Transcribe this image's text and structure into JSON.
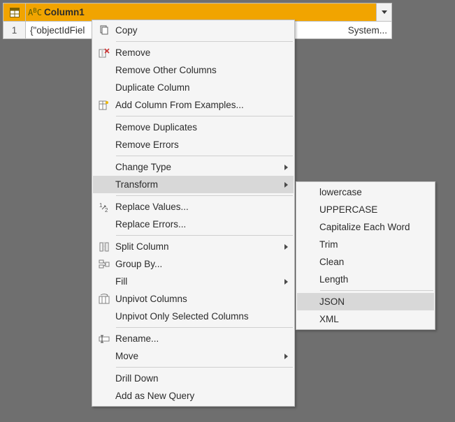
{
  "grid": {
    "column_type_prefix": "A",
    "column_type_suffix_sub": "B",
    "column_type_suffix": "C",
    "column_name": "Column1",
    "row_number": "1",
    "cell_value_left": "{\"objectIdFiel",
    "cell_value_right": "System..."
  },
  "menu1": {
    "copy": "Copy",
    "remove": "Remove",
    "remove_other": "Remove Other Columns",
    "duplicate": "Duplicate Column",
    "add_from_examples": "Add Column From Examples...",
    "remove_dups": "Remove Duplicates",
    "remove_errors": "Remove Errors",
    "change_type": "Change Type",
    "transform": "Transform",
    "replace_values": "Replace Values...",
    "replace_errors": "Replace Errors...",
    "split_column": "Split Column",
    "group_by": "Group By...",
    "fill": "Fill",
    "unpivot": "Unpivot Columns",
    "unpivot_sel": "Unpivot Only Selected Columns",
    "rename": "Rename...",
    "move": "Move",
    "drill_down": "Drill Down",
    "add_as_query": "Add as New Query"
  },
  "menu2": {
    "lowercase": "lowercase",
    "uppercase": "UPPERCASE",
    "capitalize": "Capitalize Each Word",
    "trim": "Trim",
    "clean": "Clean",
    "length": "Length",
    "json": "JSON",
    "xml": "XML"
  }
}
